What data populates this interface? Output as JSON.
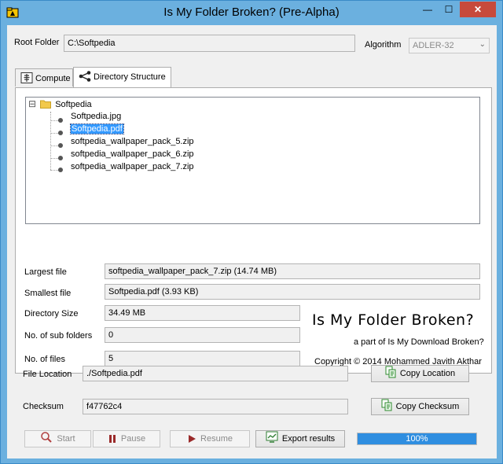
{
  "window": {
    "title": "Is My Folder Broken? (Pre-Alpha)",
    "minimize_glyph": "—",
    "maximize_glyph": "☐",
    "close_glyph": "✕"
  },
  "root": {
    "label": "Root Folder",
    "value": "C:\\Softpedia"
  },
  "algorithm": {
    "label": "Algorithm",
    "selected": "ADLER-32"
  },
  "tabs": [
    {
      "label": "Compute",
      "icon": "xray-icon",
      "active": false
    },
    {
      "label": "Directory Structure",
      "icon": "share-tree-icon",
      "active": true
    }
  ],
  "tree": {
    "root": "Softpedia",
    "expander": "⊟",
    "children": [
      {
        "name": "Softpedia.jpg",
        "selected": false
      },
      {
        "name": "Softpedia.pdf",
        "selected": true
      },
      {
        "name": "softpedia_wallpaper_pack_5.zip",
        "selected": false
      },
      {
        "name": "softpedia_wallpaper_pack_6.zip",
        "selected": false
      },
      {
        "name": "softpedia_wallpaper_pack_7.zip",
        "selected": false
      }
    ]
  },
  "stats": {
    "largest_label": "Largest file",
    "largest_value": "softpedia_wallpaper_pack_7.zip (14.74 MB)",
    "smallest_label": "Smallest file",
    "smallest_value": "Softpedia.pdf (3.93 KB)",
    "dirsize_label": "Directory Size",
    "dirsize_value": "34.49 MB",
    "subfolders_label": "No. of sub folders",
    "subfolders_value": "0",
    "files_label": "No. of files",
    "files_value": "5"
  },
  "brand": {
    "title": "Is My Folder Broken?",
    "subtitle": "a part of Is My Download Broken?",
    "copyright": "Copyright © 2014 Mohammed Javith Akthar"
  },
  "file_location": {
    "label": "File Location",
    "value": "./Softpedia.pdf",
    "button": "Copy Location"
  },
  "checksum": {
    "label": "Checksum",
    "value": "f47762c4",
    "button": "Copy Checksum"
  },
  "actions": {
    "start": "Start",
    "pause": "Pause",
    "resume": "Resume",
    "export": "Export results"
  },
  "progress": {
    "percent": 100,
    "text": "100%"
  },
  "colors": {
    "accent": "#2f8ee0",
    "selection": "#3399ff",
    "close": "#c74a3c"
  }
}
